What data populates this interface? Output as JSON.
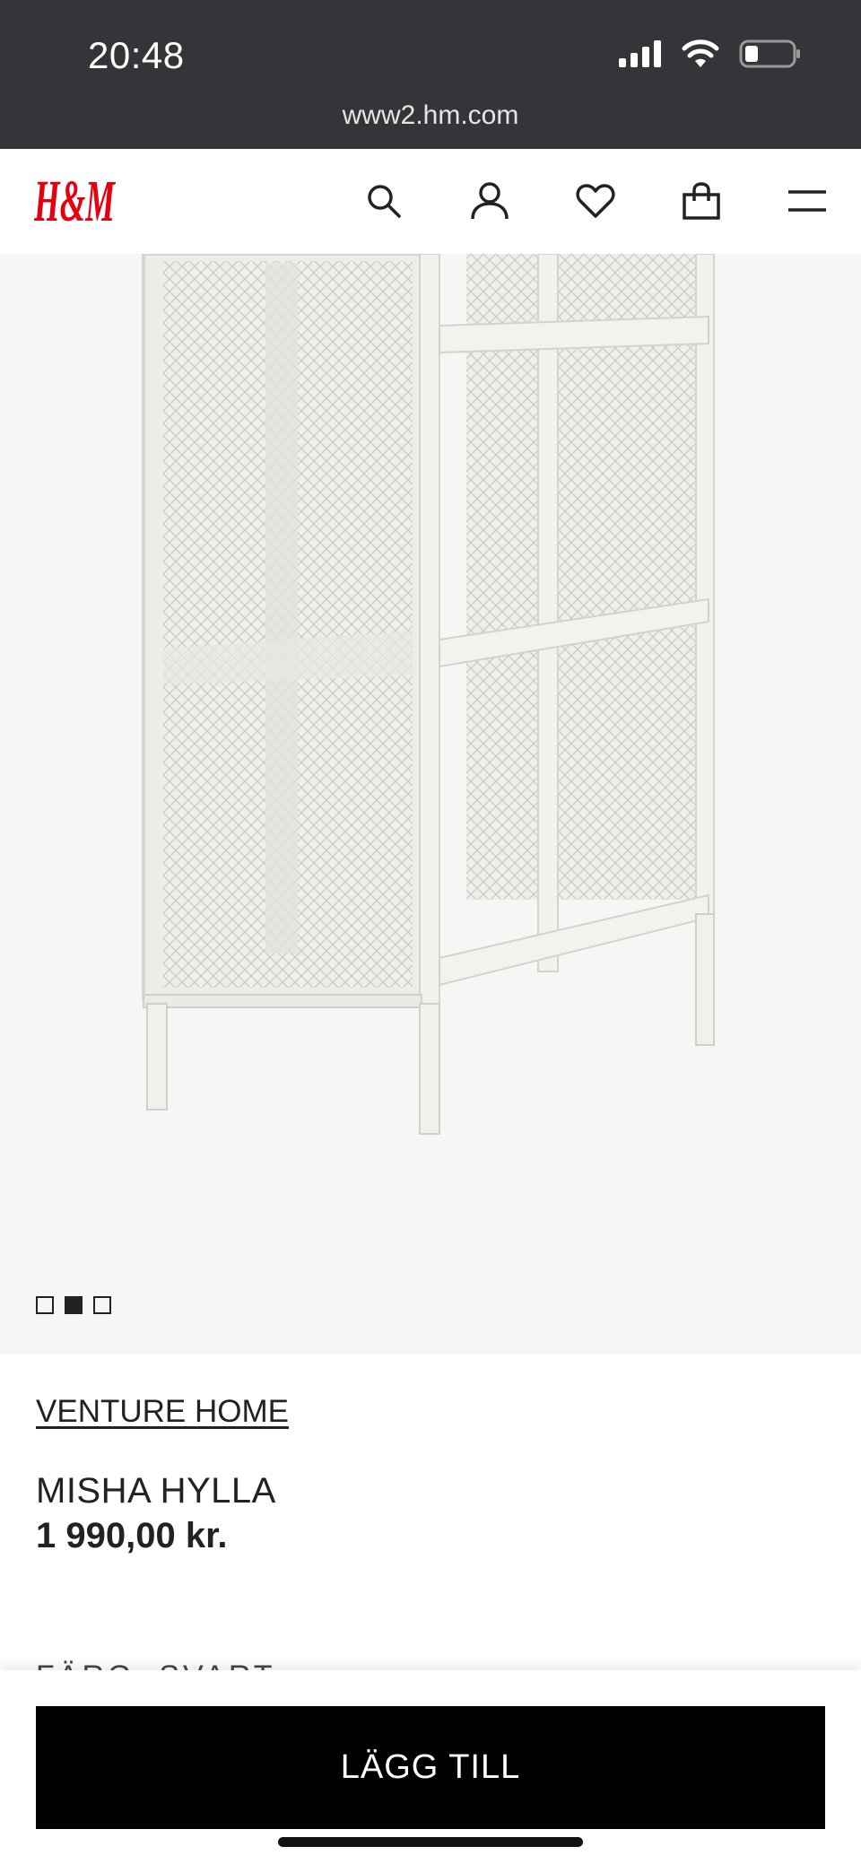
{
  "status_bar": {
    "time": "20:48",
    "url": "www2.hm.com",
    "icons": [
      "signal-icon",
      "wifi-icon",
      "battery-icon"
    ]
  },
  "header": {
    "logo": "H&M",
    "icons": [
      "search-icon",
      "account-icon",
      "heart-icon",
      "bag-icon",
      "menu-icon"
    ]
  },
  "gallery": {
    "image_count": 3,
    "active_index": 1
  },
  "product": {
    "brand": "VENTURE HOME",
    "name": "MISHA HYLLA",
    "price": "1 990,00 kr.",
    "next_section_peek": "FÄRG: SVART"
  },
  "actions": {
    "add_to_cart": "LÄGG TILL"
  },
  "colors": {
    "status_bar_bg": "#333538",
    "brand_red": "#e50010",
    "button_bg": "#000000"
  }
}
